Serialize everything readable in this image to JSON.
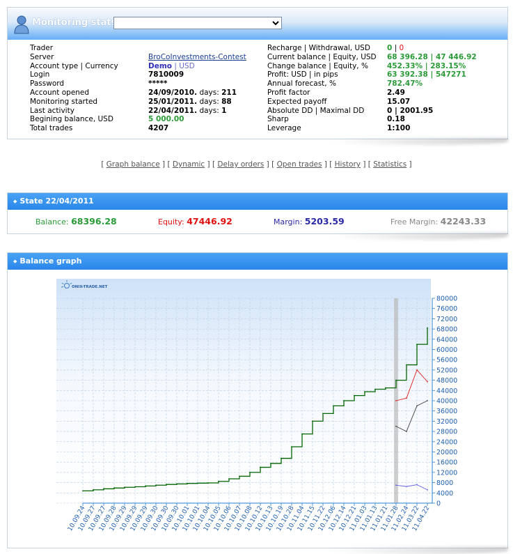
{
  "monitoring": {
    "title": "Monitoring stats:",
    "selected_account": ""
  },
  "left_stats": [
    {
      "label": "Trader",
      "value": ""
    },
    {
      "label": "Server",
      "value": "BroCoInvestments-Contest"
    },
    {
      "label": "Account type | Currency",
      "value_a": "Demo",
      "sep": " | ",
      "value_b": "USD"
    },
    {
      "label": "Login",
      "value": "7810009"
    },
    {
      "label": "Password",
      "value": "*****"
    },
    {
      "label": "Account opened",
      "value_a": "24/09/2010.",
      "mid": "  days: ",
      "value_b": "211"
    },
    {
      "label": "Monitoring started",
      "value_a": "25/01/2011.",
      "mid": "  days: ",
      "value_b": "88"
    },
    {
      "label": "Last activity",
      "value_a": "22/04/2011.",
      "mid": "  days: ",
      "value_b": "1"
    },
    {
      "label": "Begining balance, USD",
      "value": "5 000.00"
    },
    {
      "label": "Total trades",
      "value": "4207"
    }
  ],
  "right_stats": [
    {
      "label": "Recharge | Withdrawal, USD",
      "value_a": "0",
      "sep": " | ",
      "value_b": "0"
    },
    {
      "label": "Current balance | Equity, USD",
      "value_a": "68 396.28",
      "sep": "  |  ",
      "value_b": "47 446.92"
    },
    {
      "label": "Change balance | Equity, %",
      "value_a": "452.33%",
      "sep": " | ",
      "value_b": "283.15%"
    },
    {
      "label": "Profit: USD | in pips",
      "value_a": "63 392.38",
      "sep": "  |  ",
      "value_b": "547271"
    },
    {
      "label": "Annual forecast, %",
      "value": "782.47%"
    },
    {
      "label": "Profit factor",
      "value": "2.49"
    },
    {
      "label": "Expected payoff",
      "value": "15.07"
    },
    {
      "label": "Absolute DD | Maximal DD",
      "value_a": "0",
      "sep": "  |  ",
      "value_b": "2001.95"
    },
    {
      "label": "Sharp",
      "value": "0.18"
    },
    {
      "label": "Leverage",
      "value": "1:100"
    }
  ],
  "nav_links": [
    "Graph balance",
    "Dynamic",
    "Delay orders",
    "Open trades",
    "History",
    "Statistics"
  ],
  "state": {
    "title": "State 22/04/2011",
    "balance_label": "Balance:",
    "balance": "68396.28",
    "equity_label": "Equity:",
    "equity": "47446.92",
    "margin_label": "Margin:",
    "margin": "5203.59",
    "free_margin_label": "Free Margin:",
    "free_margin": "42243.33"
  },
  "balance_graph": {
    "title": "Balance graph",
    "watermark": "ONIX-TRADE.NET"
  },
  "colors": {
    "green": "#2b9b38",
    "red": "#e01010",
    "blue": "#2a2aa8",
    "gray": "#888888",
    "balance_line": "#006400",
    "equity_line": "#e02020",
    "low_line": "#404040",
    "margin_line": "#6060e0"
  },
  "chart_data": {
    "type": "line",
    "ylim": [
      0,
      80000
    ],
    "yticks": [
      "80000",
      "76000",
      "72000",
      "68000",
      "64000",
      "60000",
      "56000",
      "52000",
      "48000",
      "44000",
      "40000",
      "36000",
      "32000",
      "28000",
      "24000",
      "20000",
      "16000",
      "12000",
      "8000",
      "4000",
      "0"
    ],
    "x": [
      "10.09.24",
      "10.09.27",
      "10.09.27",
      "10.09.28",
      "10.09.29",
      "10.09.29",
      "10.09.29",
      "10.09.30",
      "10.09.30",
      "10.09.30",
      "10.10.01",
      "10.10.01",
      "10.10.04",
      "10.10.05",
      "10.10.06",
      "10.10.07",
      "10.10.08",
      "10.10.12",
      "10.10.13",
      "10.10.19",
      "10.10.28",
      "10.11.04",
      "10.11.15",
      "10.11.22",
      "10.12.06",
      "10.12.14",
      "10.12.21",
      "11.01.03",
      "11.01.13",
      "11.01.21",
      "11.01.28",
      "11.02.24",
      "11.03.22",
      "11.04.22"
    ],
    "series": [
      {
        "values": [
          4800,
          5200,
          5600,
          5900,
          6200,
          6400,
          6700,
          7000,
          7300,
          7500,
          7700,
          7800,
          7900,
          8500,
          9500,
          10500,
          12000,
          14000,
          15500,
          17500,
          22000,
          27000,
          32000,
          35000,
          38000,
          40000,
          42000,
          43500,
          44500,
          45000,
          48000,
          54000,
          62000,
          68396
        ]
      },
      {
        "values": [
          null,
          null,
          null,
          null,
          null,
          null,
          null,
          null,
          null,
          null,
          null,
          null,
          null,
          null,
          null,
          null,
          null,
          null,
          null,
          null,
          null,
          null,
          null,
          null,
          null,
          null,
          null,
          null,
          null,
          null,
          40000,
          41000,
          52000,
          47447
        ]
      },
      {
        "values": [
          null,
          null,
          null,
          null,
          null,
          null,
          null,
          null,
          null,
          null,
          null,
          null,
          null,
          null,
          null,
          null,
          null,
          null,
          null,
          null,
          null,
          null,
          null,
          null,
          null,
          null,
          null,
          null,
          null,
          null,
          30000,
          28000,
          38000,
          40000
        ]
      },
      {
        "values": [
          null,
          null,
          null,
          null,
          null,
          null,
          null,
          null,
          null,
          null,
          null,
          null,
          null,
          null,
          null,
          null,
          null,
          null,
          null,
          null,
          null,
          null,
          null,
          null,
          null,
          null,
          null,
          null,
          null,
          null,
          7000,
          6500,
          7200,
          5204
        ]
      }
    ]
  }
}
